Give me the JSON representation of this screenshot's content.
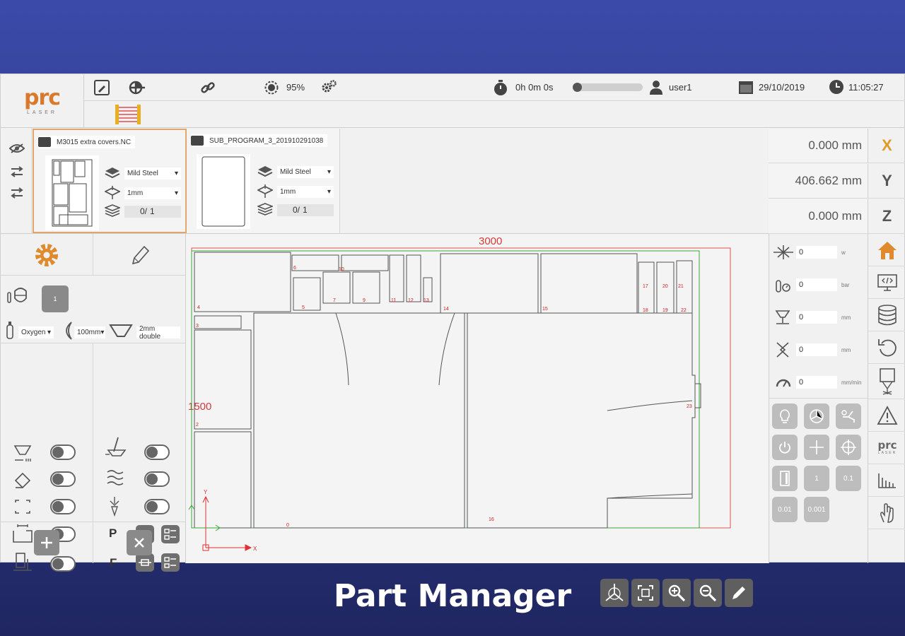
{
  "topbar": {
    "logo_main": "prc",
    "logo_sub": "LASER",
    "power_percent": "95%",
    "timer": "0h 0m 0s",
    "progress": 0.0,
    "user": "user1",
    "date": "29/10/2019",
    "time": "11:05:27"
  },
  "programs": [
    {
      "name": "M3015 extra covers.NC",
      "material": "Mild Steel",
      "thickness": "1mm",
      "count_done": "0/",
      "count_total": "1"
    },
    {
      "name": "SUB_PROGRAM_3_201910291038",
      "material": "Mild Steel",
      "thickness": "1mm",
      "count_done": "0/",
      "count_total": "1"
    }
  ],
  "axes": [
    {
      "label": "X",
      "value": "0.000 mm"
    },
    {
      "label": "Y",
      "value": "406.662 mm"
    },
    {
      "label": "Z",
      "value": "0.000 mm"
    }
  ],
  "tools": {
    "nozzle_number": "1",
    "gas": "Oxygen",
    "lens": "100mm",
    "nozzle": "2mm double",
    "p_label": "P",
    "f_label": "F"
  },
  "sheet": {
    "width_label": "3000",
    "height_label": "1500",
    "axis_x": "X",
    "axis_y": "Y"
  },
  "params": [
    {
      "icon": "laser-power-icon",
      "value": "0",
      "unit": "w"
    },
    {
      "icon": "gas-pressure-icon",
      "value": "0",
      "unit": "bar"
    },
    {
      "icon": "nozzle-height-icon",
      "value": "0",
      "unit": "mm"
    },
    {
      "icon": "focus-icon",
      "value": "0",
      "unit": "mm"
    },
    {
      "icon": "speed-icon",
      "value": "0",
      "unit": "mm/min"
    }
  ],
  "jog_steps": [
    "1",
    "0.1",
    "0.01",
    "0.001"
  ],
  "nav_logo": "prc",
  "nav_logo_sub": "LASER",
  "caption": "Part Manager",
  "colors": {
    "accent": "#e08a2e",
    "sheet_border": "#e05050",
    "work_area": "#3aa63a",
    "part_number": "#d02020"
  }
}
